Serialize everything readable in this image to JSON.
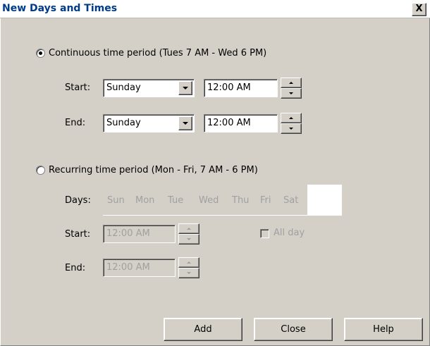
{
  "window": {
    "title": "New Days and Times",
    "close_label": "X"
  },
  "continuous": {
    "label": "Continuous time period (Tues 7 AM - Wed 6 PM)",
    "selected": true,
    "start_label": "Start:",
    "start_day": "Sunday",
    "start_time": "12:00 AM",
    "end_label": "End:",
    "end_day": "Sunday",
    "end_time": "12:00 AM"
  },
  "recurring": {
    "label": "Recurring time period (Mon - Fri, 7 AM - 6 PM)",
    "selected": false,
    "days_label": "Days:",
    "days": [
      "Sun",
      "Mon",
      "Tue",
      "Wed",
      "Thu",
      "Fri",
      "Sat"
    ],
    "start_label": "Start:",
    "start_time": "12:00 AM",
    "end_label": "End:",
    "end_time": "12:00 AM",
    "all_day_label": "All day",
    "all_day_checked": false
  },
  "buttons": {
    "add": "Add",
    "close": "Close",
    "help": "Help"
  }
}
